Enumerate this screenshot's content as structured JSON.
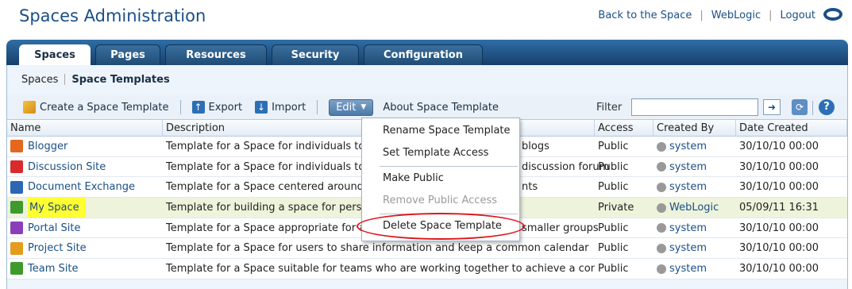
{
  "app": {
    "title": "Spaces Administration",
    "global_links": [
      "Back to the Space",
      "WebLogic",
      "Logout"
    ],
    "brand_color": "#1a4f86"
  },
  "tabs": [
    {
      "label": "Spaces",
      "active": true
    },
    {
      "label": "Pages",
      "active": false
    },
    {
      "label": "Resources",
      "active": false
    },
    {
      "label": "Security",
      "active": false
    },
    {
      "label": "Configuration",
      "active": false
    }
  ],
  "subnav": [
    "Spaces",
    "Space Templates"
  ],
  "toolbar": {
    "create": "Create a Space Template",
    "export": "Export",
    "import": "Import",
    "edit": "Edit",
    "about": "About Space Template",
    "filter_label": "Filter",
    "filter_value": ""
  },
  "table": {
    "columns": [
      "Name",
      "Description",
      "Access",
      "Created By",
      "Date Created"
    ],
    "rows": [
      {
        "name": "Blogger",
        "icon_color": "#e3681d",
        "description": "Template for a Space for individuals to",
        "desc_tail": "blogs",
        "access": "Public",
        "created_by": "system",
        "date": "30/10/10 00:00"
      },
      {
        "name": "Discussion Site",
        "icon_color": "#d92b2b",
        "description": "Template for a Space for individuals to",
        "desc_tail": "discussion forum",
        "access": "Public",
        "created_by": "system",
        "date": "30/10/10 00:00"
      },
      {
        "name": "Document Exchange",
        "icon_color": "#2b67b5",
        "description": "Template for a Space centered around",
        "desc_tail": "nts",
        "access": "Public",
        "created_by": "system",
        "date": "30/10/10 00:00"
      },
      {
        "name": "My Space",
        "icon_color": "#3f9a2e",
        "description": "Template for building a space for perso",
        "desc_tail": "",
        "access": "Private",
        "created_by": "WebLogic",
        "date": "05/09/11 16:31"
      },
      {
        "name": "Portal Site",
        "icon_color": "#8a3fb8",
        "description": "Template for a Space appropriate for a",
        "desc_tail": "smaller groups",
        "access": "Public",
        "created_by": "system",
        "date": "30/10/10 00:00"
      },
      {
        "name": "Project Site",
        "icon_color": "#e39c1c",
        "description": "Template for a Space for users to share information and keep a common calendar",
        "desc_tail": "",
        "access": "Public",
        "created_by": "system",
        "date": "30/10/10 00:00"
      },
      {
        "name": "Team Site",
        "icon_color": "#3f9a2e",
        "description": "Template for a Space suitable for teams who are working together to achieve a comm",
        "desc_tail": "",
        "access": "Public",
        "created_by": "system",
        "date": "30/10/10 00:00"
      }
    ]
  },
  "edit_menu": {
    "items": [
      {
        "label": "Rename Space Template",
        "disabled": false
      },
      {
        "label": "Set Template Access",
        "disabled": false
      },
      {
        "label": "Make Public",
        "disabled": false
      },
      {
        "label": "Remove Public Access",
        "disabled": true
      },
      {
        "label": "Delete Space Template",
        "disabled": false
      }
    ]
  }
}
